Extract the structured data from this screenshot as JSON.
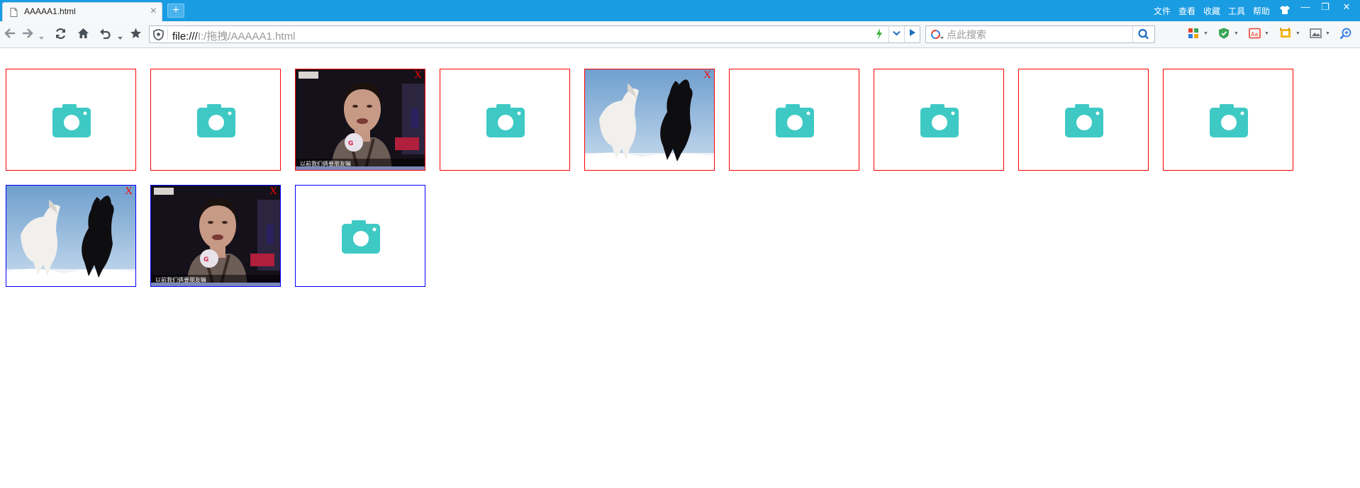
{
  "tab": {
    "title": "AAAAA1.html",
    "close": "×"
  },
  "newtab_label": "+",
  "menu": [
    "文件",
    "查看",
    "收藏",
    "工具",
    "帮助"
  ],
  "window_buttons": [
    "—",
    "❐",
    "✕"
  ],
  "toolbar": {
    "icons": [
      "back-icon",
      "forward-icon",
      "history-dropdown-icon",
      "refresh-icon",
      "home-icon",
      "undo-icon",
      "undo-dropdown-icon",
      "favorites-star-icon"
    ]
  },
  "address": {
    "protocol": "file:///",
    "path": "I:/拖拽/AAAAA1.html"
  },
  "search": {
    "placeholder": "点此搜索",
    "value": ""
  },
  "colors": {
    "titlebar": "#1a9ce2",
    "slot_border_row1": "#ff0000",
    "slot_border_row2": "#0000ff",
    "camera": "#3ec9c4",
    "remove_x": "#ff0000"
  },
  "grid": {
    "remove_label": "X",
    "portrait_caption": "以前我们俩要朋友嘛",
    "row1": [
      {
        "kind": "placeholder"
      },
      {
        "kind": "placeholder"
      },
      {
        "kind": "photo-woman"
      },
      {
        "kind": "placeholder"
      },
      {
        "kind": "photo-horses"
      },
      {
        "kind": "placeholder"
      },
      {
        "kind": "placeholder"
      },
      {
        "kind": "placeholder"
      },
      {
        "kind": "placeholder"
      }
    ],
    "row2": [
      {
        "kind": "photo-horses"
      },
      {
        "kind": "photo-woman"
      },
      {
        "kind": "placeholder"
      }
    ]
  }
}
